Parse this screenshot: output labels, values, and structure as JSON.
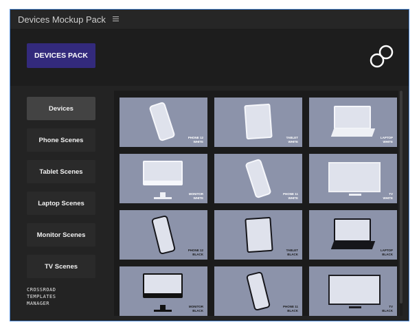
{
  "app": {
    "title": "Devices Mockup Pack"
  },
  "header": {
    "pack_button": "DEVICES PACK"
  },
  "sidebar": {
    "items": [
      {
        "label": "Devices",
        "active": true
      },
      {
        "label": "Phone Scenes",
        "active": false
      },
      {
        "label": "Tablet Scenes",
        "active": false
      },
      {
        "label": "Laptop Scenes",
        "active": false
      },
      {
        "label": "Monitor Scenes",
        "active": false
      },
      {
        "label": "TV Scenes",
        "active": false
      }
    ],
    "footer": {
      "line1": "CROSSROAD",
      "line2": "TEMPLATES",
      "line3": "MANAGER"
    }
  },
  "grid": {
    "tiles": [
      {
        "line1": "PHONE 12",
        "line2": "WHITE"
      },
      {
        "line1": "TABLET",
        "line2": "WHITE"
      },
      {
        "line1": "LAPTOP",
        "line2": "WHITE"
      },
      {
        "line1": "MONITOR",
        "line2": "WHITE"
      },
      {
        "line1": "PHONE 11",
        "line2": "WHITE"
      },
      {
        "line1": "TV",
        "line2": "WHITE"
      },
      {
        "line1": "PHONE 12",
        "line2": "BLACK"
      },
      {
        "line1": "TABLET",
        "line2": "BLACK"
      },
      {
        "line1": "LAPTOP",
        "line2": "BLACK"
      },
      {
        "line1": "MONITOR",
        "line2": "BLACK"
      },
      {
        "line1": "PHONE 11",
        "line2": "BLACK"
      },
      {
        "line1": "TV",
        "line2": "BLACK"
      }
    ]
  },
  "colors": {
    "accent": "#332a7c",
    "panel_border": "#4a86d4",
    "tile_background": "#8c93aa",
    "active_nav": "#434343"
  },
  "icons": {
    "menu": "hamburger-icon",
    "logo": "crossroad-logo-icon"
  }
}
